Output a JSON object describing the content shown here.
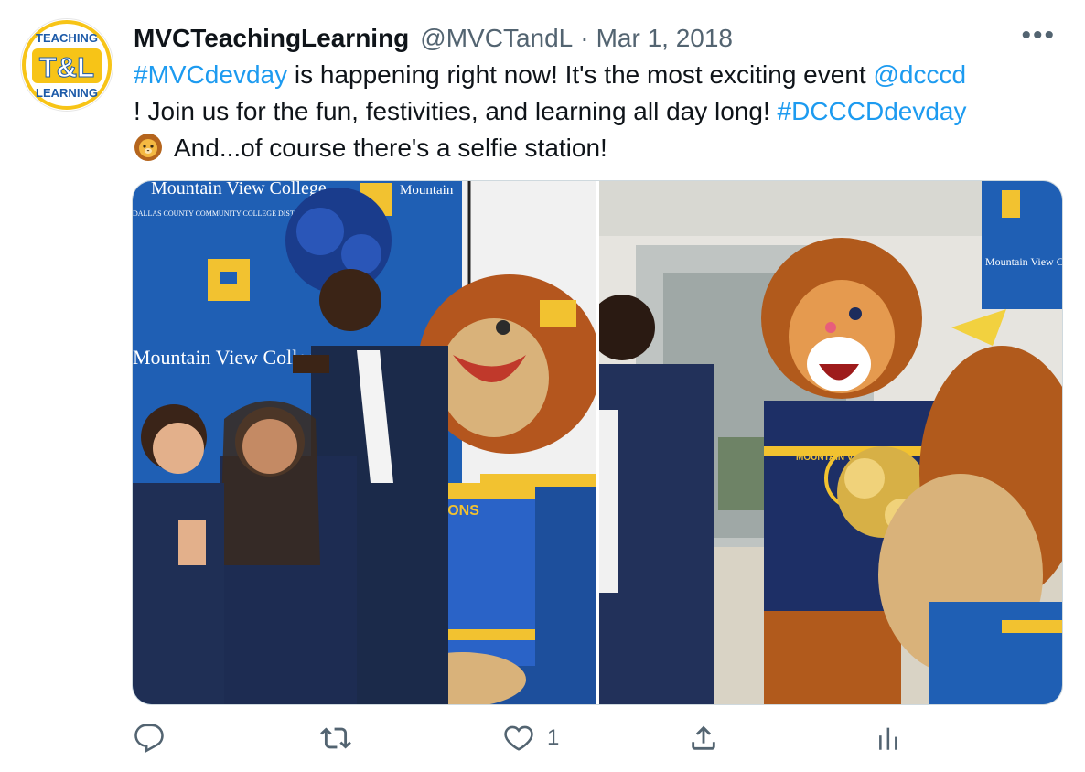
{
  "author": {
    "display_name": "MVCTeachingLearning",
    "handle": "@MVCTandL",
    "separator": "·",
    "date": "Mar 1, 2018",
    "avatar": {
      "top_text": "TEACHING",
      "main_text": "T&L",
      "bottom_text": "LEARNING",
      "colors": {
        "yellow": "#f7c417",
        "blue": "#1c5aa8"
      }
    }
  },
  "more_icon": "more-horizontal-icon",
  "more_label": "•••",
  "tweet": {
    "line1": {
      "hashtag": "#MVCdevday",
      "text": " is happening right now! It's the most exciting event ",
      "mention": "@dcccd"
    },
    "line2": {
      "text": "!  Join us for the fun, festivities, and learning all day long!  ",
      "hashtag": "#DCCCDdevday"
    },
    "line3": {
      "emoji": "lion-face-emoji",
      "text": "And...of course there's a selfie station!"
    }
  },
  "media": {
    "photo1": {
      "banner_title": "Mountain View College",
      "banner_subtitle": "DALLAS COUNTY COMMUNITY COLLEGE DISTRICT",
      "banner_short": "Mountain",
      "mascot_shirt": "LIONS"
    },
    "photo2": {
      "banner_title": "Mountain View College",
      "shirt_text": "MOUNTAIN VIEW C"
    }
  },
  "actions": {
    "reply": {
      "icon": "reply-icon",
      "count": ""
    },
    "retweet": {
      "icon": "retweet-icon",
      "count": ""
    },
    "like": {
      "icon": "heart-icon",
      "count": "1"
    },
    "share": {
      "icon": "share-icon",
      "count": ""
    },
    "analytics": {
      "icon": "analytics-icon",
      "count": ""
    }
  },
  "colors": {
    "link": "#1d9bf0",
    "secondary_text": "#536471",
    "primary_text": "#0f1419",
    "banner_blue": "#1f5fb4",
    "mvc_yellow": "#f2c230"
  }
}
